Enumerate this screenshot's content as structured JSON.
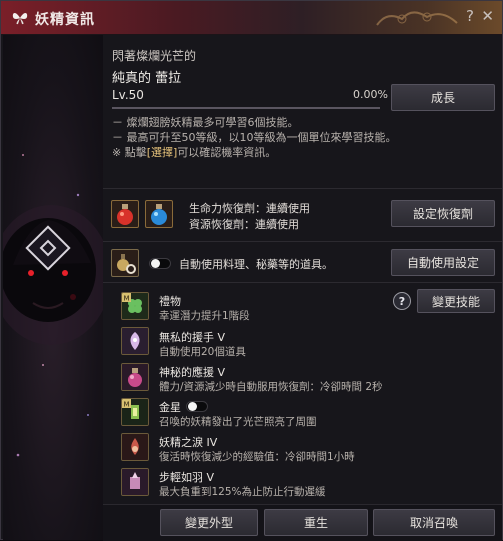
{
  "window": {
    "title": "妖精資訊",
    "help_icon": "?",
    "close_icon": "✕"
  },
  "header": {
    "subtitle": "閃著燦爛光芒的",
    "name": "純真的 蕾拉",
    "level": "Lv.50",
    "exp_percent": "0.00%",
    "exp_fraction": 0.0,
    "grow_button": "成長"
  },
  "notes": {
    "line1": "－ 燦爛翅膀妖精最多可學習6個技能。",
    "line2": "－ 最高可升至50等級，以10等級為一個單位來學習技能。",
    "line3_prefix": "※ 點擊",
    "line3_highlight": "[選擇]",
    "line3_suffix": "可以確認機率資訊。"
  },
  "recovery": {
    "hp_label": "生命力恢復劑：連續使用",
    "mp_label": "資源恢復劑：連續使用",
    "set_button": "設定恢復劑"
  },
  "auto_use": {
    "label": "自動使用料理、秘藥等的道具。",
    "toggle_on": false,
    "settings_button": "自動使用設定"
  },
  "skills": {
    "change_button": "變更技能",
    "help_icon": "?",
    "items": [
      {
        "title": "禮物",
        "desc": "幸運潛力提升1階段",
        "badge": "M",
        "icon": "clover-icon"
      },
      {
        "title": "無私的援手 V",
        "desc": "自動使用20個道具",
        "badge": "",
        "icon": "fairy-hand-icon"
      },
      {
        "title": "神秘的應援 V",
        "desc": "體力/資源減少時自動服用恢復劑：冷卻時間 2秒",
        "badge": "",
        "icon": "potion-bottle-icon"
      },
      {
        "title": "金星",
        "desc": "召喚的妖精發出了光芒照亮了周圍",
        "badge": "M",
        "icon": "lantern-icon",
        "toggle_on": false
      },
      {
        "title": "妖精之淚 IV",
        "desc": "復活時恢復減少的經驗值：冷卻時間1小時",
        "badge": "",
        "icon": "tear-icon"
      },
      {
        "title": "步輕如羽 V",
        "desc": "最大負重到125%為止防止行動遲緩",
        "badge": "",
        "icon": "feather-icon"
      }
    ]
  },
  "footer": {
    "change_look": "變更外型",
    "rebirth": "重生",
    "cancel_summon": "取消召喚"
  }
}
